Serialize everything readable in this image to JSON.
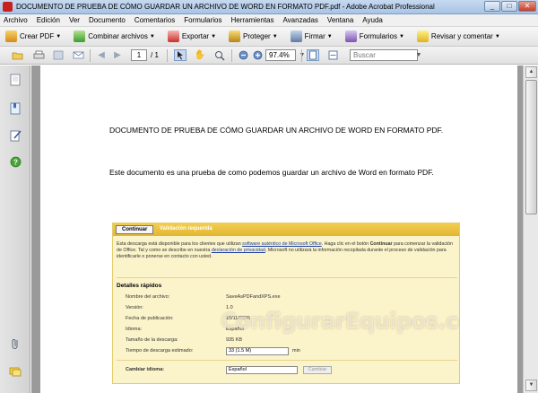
{
  "window": {
    "title": "DOCUMENTO DE PRUEBA DE CÓMO GUARDAR UN ARCHIVO DE WORD EN FORMATO PDF.pdf - Adobe Acrobat Professional",
    "minimize": "_",
    "restore": "□",
    "close": "✕"
  },
  "menu": [
    "Archivo",
    "Edición",
    "Ver",
    "Documento",
    "Comentarios",
    "Formularios",
    "Herramientas",
    "Avanzadas",
    "Ventana",
    "Ayuda"
  ],
  "tasks": {
    "create_pdf": "Crear PDF",
    "combine": "Combinar archivos",
    "export": "Exportar",
    "protect": "Proteger",
    "sign": "Firmar",
    "forms": "Formularios",
    "review": "Revisar y comentar"
  },
  "nav": {
    "page_current": "1",
    "page_total": "/ 1",
    "zoom": "97.4%",
    "search_placeholder": "Buscar"
  },
  "document": {
    "heading": "DOCUMENTO DE PRUEBA DE CÓMO GUARDAR UN ARCHIVO DE WORD EN FORMATO PDF.",
    "paragraph": "Este documento es una prueba de como podemos guardar un archivo de Word en formato PDF."
  },
  "embed": {
    "continue_button": "Continuar",
    "bar_title": "Validación requerida",
    "intro_1": "Esta descarga está disponible para los clientes que utilizan ",
    "intro_link1": "software auténtico de Microsoft Office",
    "intro_2": ". Haga clic en el botón ",
    "intro_bold": "Continuar",
    "intro_3": " para comenzar la validación de Office. Tal y como se describe en nuestra ",
    "intro_link2": "declaración de privacidad",
    "intro_4": ", Microsoft no utilizará la información recopilada durante el proceso de validación para identificarle o ponerse en contacto con usted.",
    "quick_title": "Detalles rápidos",
    "rows": [
      {
        "label": "Nombre del archivo:",
        "value": "SaveAsPDFandXPS.exe"
      },
      {
        "label": "Versión:",
        "value": "1.0"
      },
      {
        "label": "Fecha de publicación:",
        "value": "10/11/2006"
      },
      {
        "label": "Idioma:",
        "value": "Español"
      },
      {
        "label": "Tamaño de la descarga:",
        "value": "935 KB"
      },
      {
        "label": "Tiempo de descarga estimado:",
        "value": "33 (1.5 M)"
      }
    ],
    "time_unit": "min",
    "change_language": "Cambiar idioma:",
    "language_select": "Español",
    "change_button": "Cambiar",
    "watermark": "ConfigurarEquipos.com"
  }
}
